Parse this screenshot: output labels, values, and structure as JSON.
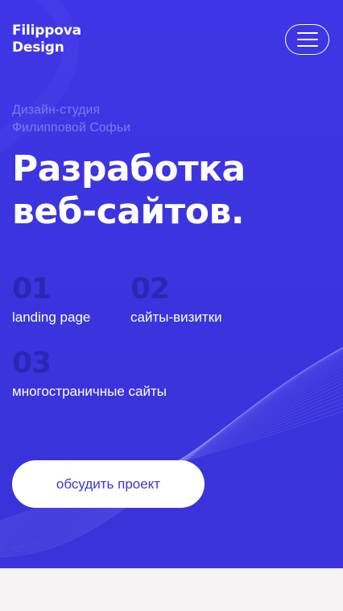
{
  "header": {
    "logo_line1": "Filippova",
    "logo_line2": "Design"
  },
  "hero": {
    "subtitle_line1": "Дизайн-студия",
    "subtitle_line2": "Филипповой Софьи",
    "headline_line1": "Разработка",
    "headline_line2": "веб-сайтов.",
    "features": [
      {
        "number": "01",
        "label": "landing page"
      },
      {
        "number": "02",
        "label": "сайты-визитки"
      },
      {
        "number": "03",
        "label": "многостраничные сайты"
      }
    ],
    "cta_label": "обсудить проект"
  },
  "colors": {
    "accent": "#3f35e6",
    "number": "#2c26b5",
    "subtitle": "#7f79ee",
    "background": "#f5f3f3"
  }
}
